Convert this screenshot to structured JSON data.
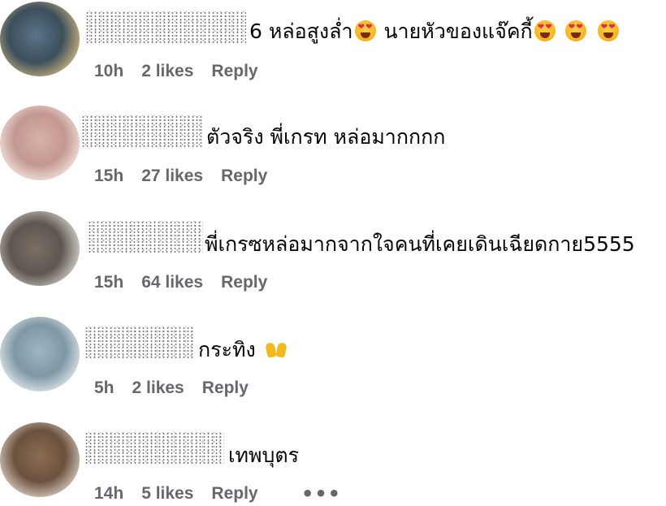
{
  "comments": [
    {
      "text": "6 หล่อสูงล่ำ",
      "text_after": " นายหัวของแจ๊คกี้",
      "time": "10h",
      "likes": "2 likes",
      "reply": "Reply",
      "emoji_after_text": "heart-eyes-emoji",
      "emoji_tail": [
        "heart-eyes-emoji",
        "heart-eyes-emoji",
        "heart-eyes-emoji"
      ],
      "avatar_color": "#3f5a6b"
    },
    {
      "text": "ตัวจริง พี่เกรท หล่อมากกกก",
      "time": "15h",
      "likes": "27 likes",
      "reply": "Reply",
      "avatar_color": "#c9a29a"
    },
    {
      "text": "พี่เกรซหล่อมากจากใจคนที่เคยเดินเฉียดกาย5555",
      "time": "15h",
      "likes": "64 likes",
      "reply": "Reply",
      "avatar_color": "#6b625b"
    },
    {
      "text": "กระทิง",
      "time": "5h",
      "likes": "2 likes",
      "reply": "Reply",
      "emoji_after_text": "raising-hands-emoji",
      "avatar_color": "#8fa9b8"
    },
    {
      "text": "เทพบุตร",
      "time": "14h",
      "likes": "5 likes",
      "reply": "Reply",
      "more": "•••",
      "avatar_color": "#7a6048"
    }
  ]
}
